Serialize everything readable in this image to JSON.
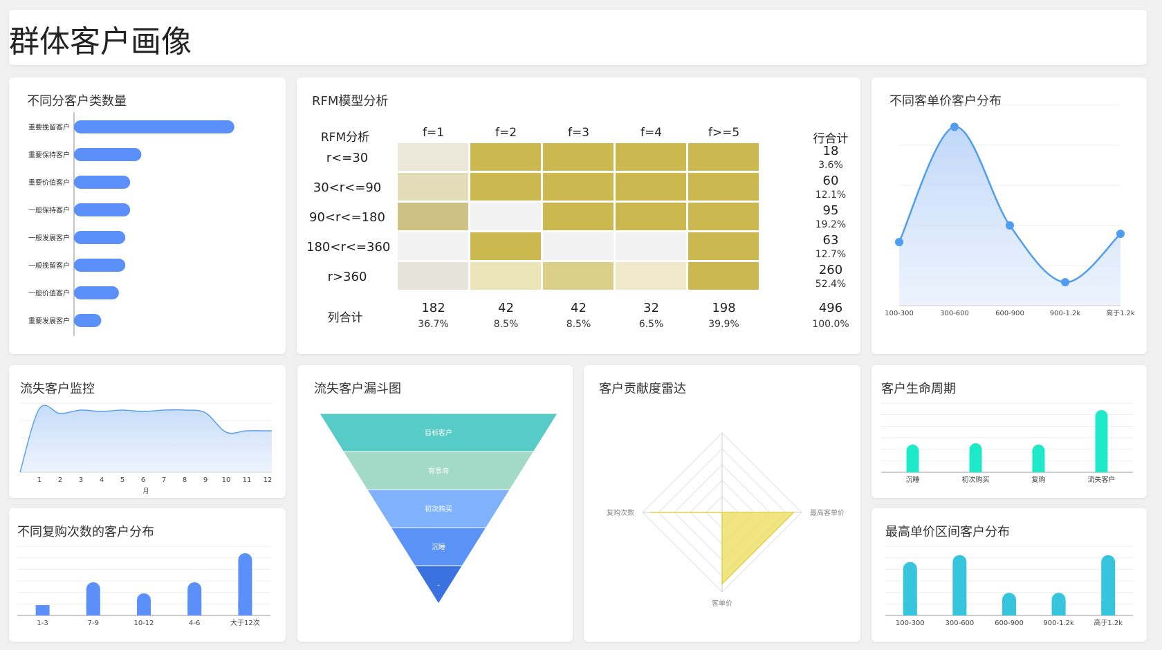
{
  "page": {
    "title": "群体客户画像"
  },
  "colors": {
    "blue": "#5b8ff9",
    "gold": "#cbb950",
    "teal": "#1de9c8",
    "cyan": "#36c5dc",
    "radar": "#ede06a"
  },
  "segments": {
    "title": "不同分客户类数量",
    "chart_data": {
      "type": "bar",
      "orientation": "horizontal",
      "categories": [
        "重要挽留客户",
        "重要保持客户",
        "重要价值客户",
        "一般保持客户",
        "一般发展客户",
        "一般挽留客户",
        "一般价值客户",
        "重要发展客户"
      ],
      "values": [
        100,
        42,
        35,
        35,
        32,
        32,
        28,
        17
      ],
      "xlim": [
        0,
        110
      ]
    }
  },
  "rfm": {
    "title": "RFM模型分析",
    "corner_label": "RFM分析",
    "row_total_label": "行合计",
    "col_total_label": "列合计",
    "columns": [
      "f=1",
      "f=2",
      "f=3",
      "f=4",
      "f>=5"
    ],
    "rows": [
      {
        "label": "r<=30",
        "total": "18",
        "pct": "3.6%"
      },
      {
        "label": "30<r<=90",
        "total": "60",
        "pct": "12.1%"
      },
      {
        "label": "90<r<=180",
        "total": "95",
        "pct": "19.2%"
      },
      {
        "label": "180<r<=360",
        "total": "63",
        "pct": "12.7%"
      },
      {
        "label": "r>360",
        "total": "260",
        "pct": "52.4%"
      }
    ],
    "col_totals": [
      {
        "total": "182",
        "pct": "36.7%"
      },
      {
        "total": "42",
        "pct": "8.5%"
      },
      {
        "total": "42",
        "pct": "8.5%"
      },
      {
        "total": "32",
        "pct": "6.5%"
      },
      {
        "total": "198",
        "pct": "39.9%"
      }
    ],
    "grand_total": {
      "total": "496",
      "pct": "100.0%"
    },
    "chart_data": {
      "type": "heatmap",
      "colors": [
        [
          "#ebe8d9",
          "#cbb950",
          "#cbb950",
          "#cbb950",
          "#cbb950"
        ],
        [
          "#e2dcb8",
          "#cbb950",
          "#cbb950",
          "#cbb950",
          "#cbb950"
        ],
        [
          "#cfc183",
          "#f2f2f2",
          "#cbb950",
          "#cbb950",
          "#cbb950"
        ],
        [
          "#f2f2f2",
          "#cbb950",
          "#f2f2f2",
          "#f2f2f2",
          "#cbb950"
        ],
        [
          "#e6e3da",
          "#ece4b9",
          "#dccf8a",
          "#efe9c9",
          "#cbb950"
        ]
      ]
    }
  },
  "price_dist": {
    "title": "不同客单价客户分布",
    "chart_data": {
      "type": "line",
      "smooth": true,
      "area": true,
      "categories": [
        "100-300",
        "300-600",
        "600-900",
        "900-1.2k",
        "高于1.2k"
      ],
      "values": [
        38,
        107,
        48,
        14,
        43
      ],
      "ylim": [
        0,
        120
      ]
    }
  },
  "churn_monitor": {
    "title": "流失客户监控",
    "chart_data": {
      "type": "area",
      "categories": [
        "1",
        "2",
        "3",
        "4",
        "5",
        "6",
        "7",
        "8",
        "9",
        "10",
        "11",
        "12"
      ],
      "xlabel": "月",
      "values": [
        92,
        85,
        90,
        88,
        90,
        88,
        90,
        90,
        86,
        58,
        60,
        60
      ],
      "ylim": [
        0,
        100
      ]
    }
  },
  "funnel": {
    "title": "流失客户漏斗图",
    "chart_data": {
      "type": "funnel",
      "categories": [
        "目标客户",
        "有意向",
        "初次购买",
        "沉睡",
        "-"
      ],
      "values": [
        100,
        80,
        60,
        40,
        20
      ],
      "colors": [
        "#56cbc7",
        "#a3d9c7",
        "#7fb2fb",
        "#5a93f5",
        "#3a73e0"
      ]
    }
  },
  "radar": {
    "title": "客户贡献度雷达",
    "chart_data": {
      "type": "radar",
      "indicators": [
        "复购次数",
        "最高客单价",
        "客单价",
        ""
      ],
      "values": [
        0.9,
        0.9,
        0.9,
        0
      ]
    }
  },
  "lifecycle": {
    "title": "客户生命周期",
    "chart_data": {
      "type": "bar",
      "categories": [
        "沉睡",
        "初次购买",
        "复购",
        "流失客户"
      ],
      "values": [
        40,
        42,
        40,
        90
      ],
      "ylim": [
        0,
        100
      ]
    }
  },
  "repurchase": {
    "title": "不同复购次数的客户分布",
    "chart_data": {
      "type": "bar",
      "categories": [
        "1-3",
        "7-9",
        "10-12",
        "4-6",
        "大于12次"
      ],
      "values": [
        15,
        48,
        32,
        48,
        90
      ],
      "ylim": [
        0,
        100
      ]
    }
  },
  "max_price": {
    "title": "最高单价区间客户分布",
    "chart_data": {
      "type": "bar",
      "categories": [
        "100-300",
        "300-600",
        "600-900",
        "900-1.2k",
        "高于1.2k"
      ],
      "values": [
        85,
        96,
        36,
        36,
        96
      ],
      "ylim": [
        0,
        110
      ]
    }
  }
}
